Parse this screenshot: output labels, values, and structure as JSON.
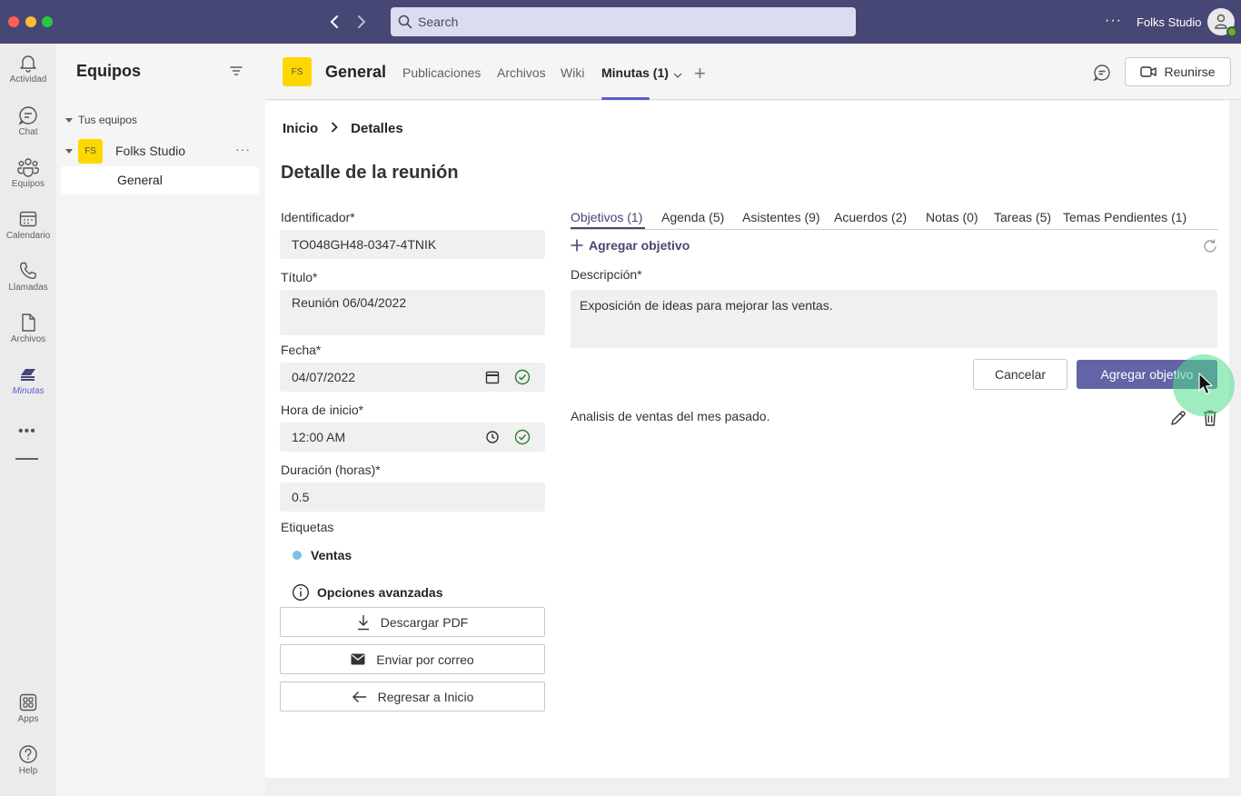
{
  "titlebar": {
    "search_placeholder": "Search",
    "more": "···",
    "org_name": "Folks Studio"
  },
  "rail": {
    "items": [
      {
        "label": "Actividad",
        "icon": "bell-icon"
      },
      {
        "label": "Chat",
        "icon": "chat-icon"
      },
      {
        "label": "Equipos",
        "icon": "teams-icon"
      },
      {
        "label": "Calendario",
        "icon": "calendar-icon"
      },
      {
        "label": "Llamadas",
        "icon": "phone-icon"
      },
      {
        "label": "Archivos",
        "icon": "file-icon"
      },
      {
        "label": "Minutas",
        "icon": "minutas-icon",
        "active": true
      }
    ],
    "more": "•••",
    "bottom": [
      {
        "label": "Apps",
        "icon": "apps-icon"
      },
      {
        "label": "Help",
        "icon": "help-icon"
      }
    ]
  },
  "teams": {
    "title": "Equipos",
    "section": "Tus equipos",
    "team_badge": "FS",
    "team_name": "Folks Studio",
    "team_more": "···",
    "channel": "General"
  },
  "channel_header": {
    "badge": "FS",
    "name": "General",
    "tabs": [
      "Publicaciones",
      "Archivos",
      "Wiki",
      "Minutas (1)"
    ],
    "active_tab": "Minutas (1)",
    "meet_label": "Reunirse"
  },
  "breadcrumb": {
    "home": "Inicio",
    "current": "Detalles"
  },
  "page_title": "Detalle de la reunión",
  "form": {
    "identifier_label": "Identificador*",
    "identifier_value": "TO048GH48-0347-4TNIK",
    "title_label": "Título*",
    "title_value": "Reunión 06/04/2022",
    "date_label": "Fecha*",
    "date_value": "04/07/2022",
    "time_label": "Hora de inicio*",
    "time_value": "12:00 AM",
    "duration_label": "Duración (horas)*",
    "duration_value": "0.5",
    "tags_label": "Etiquetas",
    "tag": "Ventas",
    "advanced": "Opciones avanzadas"
  },
  "actions": {
    "download": "Descargar PDF",
    "email": "Enviar por correo",
    "back": "Regresar a Inicio"
  },
  "detail_tabs": [
    "Objetivos (1)",
    "Agenda (5)",
    "Asistentes (9)",
    "Acuerdos (2)",
    "Notas (0)",
    "Tareas (5)",
    "Temas Pendientes (1)"
  ],
  "objectives": {
    "add_label": "Agregar objetivo",
    "description_label": "Descripción*",
    "description_value": "Exposición de ideas para mejorar las ventas.",
    "cancel": "Cancelar",
    "submit": "Agregar objetivo",
    "items": [
      "Analisis de ventas del mes pasado."
    ]
  },
  "colors": {
    "titlebar": "#464775",
    "accent": "#6264a7",
    "badge": "#ffd700",
    "tag": "#7dbfe8",
    "check": "#2e7d32"
  }
}
